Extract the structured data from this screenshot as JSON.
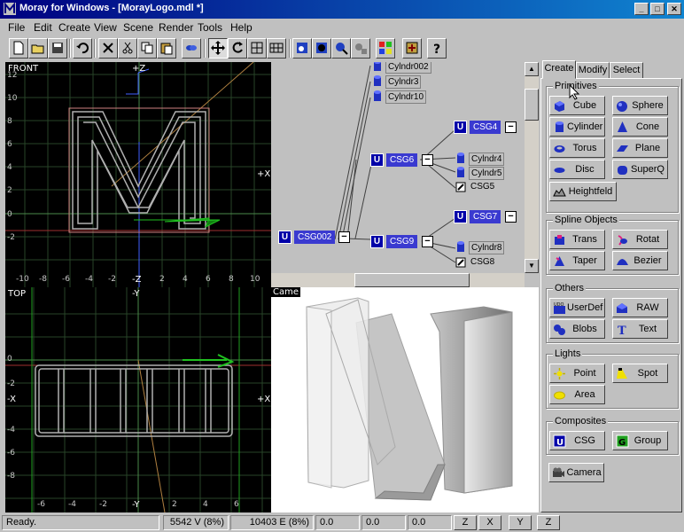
{
  "window": {
    "title": "Moray for Windows - [MorayLogo.mdl *]",
    "buttons": [
      "_",
      "□",
      "✕"
    ]
  },
  "menu": [
    {
      "label": "File",
      "accel": "F"
    },
    {
      "label": "Edit",
      "accel": "E"
    },
    {
      "label": "Create",
      "accel": "C"
    },
    {
      "label": "View",
      "accel": "V"
    },
    {
      "label": "Scene",
      "accel": "e"
    },
    {
      "label": "Render",
      "accel": "R"
    },
    {
      "label": "Tools",
      "accel": "T"
    },
    {
      "label": "Help",
      "accel": "H"
    }
  ],
  "toolbar": {
    "icons": [
      "new-file-icon",
      "open-file-icon",
      "save-icon",
      "undo-icon",
      "delete-icon",
      "cut-icon",
      "copy-icon",
      "paste-icon",
      "link-icon",
      "select-move-icon",
      "rotate-icon",
      "scale-icon",
      "grid-icon",
      "render-wire-icon",
      "render-icon",
      "render-scene-icon",
      "render-settings-icon",
      "material-icon",
      "settings-icon",
      "help-icon"
    ]
  },
  "viewports": {
    "front": {
      "label": "FRONT",
      "axis_top": "+Z",
      "axis_right": "+X",
      "axis_bottom": "-Z",
      "y_ticks": [
        "12",
        "10",
        "8",
        "6",
        "4",
        "2",
        "0",
        "-2"
      ],
      "x_ticks": [
        "-10",
        "-8",
        "-6",
        "-4",
        "-2",
        "2",
        "4",
        "6",
        "8",
        "10"
      ]
    },
    "top": {
      "label": "TOP",
      "axis_top": "-Y",
      "axis_right": "+X",
      "axis_left": "-X",
      "axis_bottom": "-Y",
      "y_ticks": [
        "0",
        "-2",
        "-4",
        "-6",
        "-8"
      ],
      "x_ticks": [
        "-6",
        "-4",
        "-2",
        "2",
        "4",
        "6"
      ]
    },
    "camera": {
      "label": "Came"
    }
  },
  "tree": {
    "leaves": [
      {
        "name": "Cylndr002"
      },
      {
        "name": "Cylndr3"
      },
      {
        "name": "Cylndr10"
      },
      {
        "name": "Cylndr4"
      },
      {
        "name": "Cylndr5"
      },
      {
        "name": "CSG5"
      },
      {
        "name": "Cylndr8"
      },
      {
        "name": "CSG8"
      }
    ],
    "csg_nodes": [
      {
        "name": "CSG4",
        "type": "U"
      },
      {
        "name": "CSG6",
        "type": "U"
      },
      {
        "name": "CSG7",
        "type": "U"
      },
      {
        "name": "CSG002",
        "type": "U"
      },
      {
        "name": "CSG9",
        "type": "U"
      }
    ],
    "collapse_symbol": "−"
  },
  "panel": {
    "tabs": [
      "Create",
      "Modify",
      "Select"
    ],
    "active_tab": "Create",
    "groups": [
      {
        "title": "Primitives",
        "buttons": [
          "Cube",
          "Sphere",
          "Cylinder",
          "Cone",
          "Torus",
          "Plane",
          "Disc",
          "SuperQ",
          "Heightfeld"
        ]
      },
      {
        "title": "Spline Objects",
        "buttons": [
          "Trans",
          "Rotat",
          "Taper",
          "Bezier"
        ]
      },
      {
        "title": "Others",
        "buttons": [
          "UserDef",
          "RAW",
          "Blobs",
          "Text"
        ]
      },
      {
        "title": "Lights",
        "buttons": [
          "Point",
          "Spot",
          "Area"
        ]
      },
      {
        "title": "Composites",
        "buttons": [
          "CSG",
          "Group"
        ]
      }
    ],
    "camera_button": "Camera"
  },
  "status": {
    "message": "Ready.",
    "vertices": "5542 V (8%)",
    "edges": "10403 E (8%)",
    "x": "0.0",
    "y": "0.0",
    "z": "0.0",
    "axis_buttons": [
      "Z",
      "X",
      "Y",
      "Z"
    ]
  },
  "colors": {
    "title_start": "#000080",
    "title_end": "#1084d0",
    "csg_node_bg": "#3a3ad0",
    "csg_u_bg": "#0000a8",
    "viewport_bg": "#000000",
    "grid": "#2e4a2e"
  }
}
